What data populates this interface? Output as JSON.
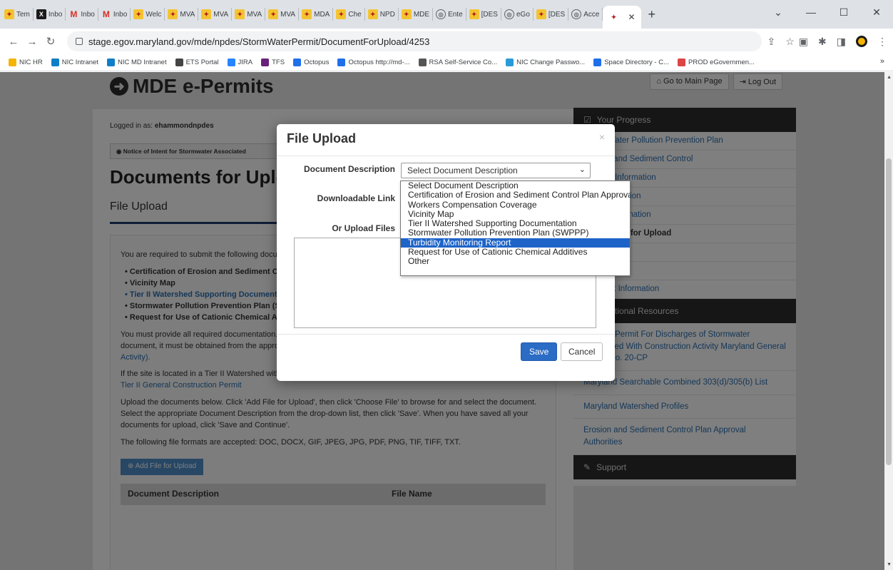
{
  "browser": {
    "tabs": [
      {
        "icon": "mde",
        "label": "Tem"
      },
      {
        "icon": "x",
        "label": "Inbo"
      },
      {
        "icon": "m",
        "label": "Inbo"
      },
      {
        "icon": "m",
        "label": "Inbo"
      },
      {
        "icon": "mde",
        "label": "Welc"
      },
      {
        "icon": "mde",
        "label": "MVA"
      },
      {
        "icon": "mde",
        "label": "MVA"
      },
      {
        "icon": "mde",
        "label": "MVA"
      },
      {
        "icon": "mde",
        "label": "MVA"
      },
      {
        "icon": "mde",
        "label": "MDA"
      },
      {
        "icon": "mde",
        "label": "Che"
      },
      {
        "icon": "mde",
        "label": "NPD"
      },
      {
        "icon": "mde",
        "label": "MDE"
      },
      {
        "icon": "g",
        "label": "Ente"
      },
      {
        "icon": "mde",
        "label": "[DES"
      },
      {
        "icon": "g",
        "label": "eGo"
      },
      {
        "icon": "mde",
        "label": "[DES"
      },
      {
        "icon": "g",
        "label": "Acce"
      }
    ],
    "url": "stage.egov.maryland.gov/mde/npdes/StormWaterPermit/DocumentForUpload/4253",
    "bookmarks": [
      "NIC HR",
      "NIC Intranet",
      "NIC MD Intranet",
      "ETS Portal",
      "JIRA",
      "TFS",
      "Octopus",
      "Octopus http://md-...",
      "RSA Self-Service Co...",
      "NIC Change Passwo...",
      "Space Directory - C...",
      "PROD eGovernmen..."
    ],
    "bookmarks_more": "»"
  },
  "site": {
    "logo": "MDE e-Permits",
    "go_main": "Go to Main Page",
    "logout": "Log Out",
    "logged_in_label": "Logged in as:",
    "logged_in_user": "ehammondnpdes",
    "breadcrumb": "Notice of Intent for Stormwater Associated",
    "page_title": "Documents for Upload",
    "section_title": "File Upload",
    "intro": "You are required to submit the following documents:",
    "required_docs": [
      {
        "label": "Certification of Erosion and Sediment Control Plan Approval",
        "link": false
      },
      {
        "label": "Vicinity Map",
        "link": false
      },
      {
        "label": "Tier II Watershed Supporting Documentation",
        "link": true
      },
      {
        "label": "Stormwater Pollution Prevention Plan (SWPPP)",
        "link": false
      },
      {
        "label": "Request for Use of Cationic Chemical Additives",
        "link": false
      }
    ],
    "para1": "You must provide all required documentation. If the site requires an Erosion and Sediment Control plan approval document, it must be obtained from the appropriate approval authority). More information is available on",
    "para1_link": "Construction Activity).",
    "para2": "If the site is located in a Tier II Watershed with no assimilative capacity you must contact MDE Tier II Review:",
    "para2_link": "Tier II General Construction Permit",
    "para3": "Upload the documents below. Click 'Add File for Upload', then click 'Choose File' to browse for and select the document. Select the appropriate Document Description from the drop-down list, then click 'Save'. When you have saved all your documents for upload, click 'Save and Continue'.",
    "para4": "The following file formats are accepted: DOC, DOCX, GIF, JPEG, JPG, PDF, PNG, TIF, TIFF, TXT.",
    "add_file": "Add File for Upload",
    "table_headers": [
      "Document Description",
      "File Name"
    ]
  },
  "sidebar": {
    "progress_title": "Your Progress",
    "progress_items": [
      {
        "label": "Storm Water Pollution Prevention Plan",
        "current": false
      },
      {
        "label": "Erosion and Sediment Control",
        "current": false
      },
      {
        "label": "General Information",
        "current": false
      },
      {
        "label": "Site Information",
        "current": false
      },
      {
        "label": "Owner Information",
        "current": false
      },
      {
        "label": "Documents for Upload",
        "current": true
      },
      {
        "label": "",
        "current": false
      },
      {
        "label": "",
        "current": false
      },
      {
        "label": "Payment Information",
        "current": false
      }
    ],
    "resources_title": "Additional Resources",
    "resources": [
      "General Permit For Discharges of Stormwater Associated With Construction Activity Maryland General Permit No. 20-CP",
      "Maryland Searchable Combined 303(d)/305(b) List",
      "Maryland Watershed Profiles",
      "Erosion and Sediment Control Plan Approval Authorities"
    ],
    "support_title": "Support"
  },
  "modal": {
    "title": "File Upload",
    "close": "×",
    "doc_desc_label": "Document Description",
    "download_label": "Downloadable Link",
    "upload_label": "Or Upload Files",
    "selected": "Select Document Description",
    "options": [
      "Select Document Description",
      "Certification of Erosion and Sediment Control Plan Approval",
      "Workers Compensation Coverage",
      "Vicinity Map",
      "Tier II Watershed Supporting Documentation",
      "Stormwater Pollution Prevention Plan (SWPPP)",
      "Turbidity Monitoring Report",
      "Request for Use of Cationic Chemical Additives",
      "Other"
    ],
    "highlighted_index": 6,
    "save": "Save",
    "cancel": "Cancel"
  },
  "colors": {
    "primary": "#2b6cc4",
    "highlight": "#1e64c8",
    "link": "#2a6fb0",
    "dark": "#2d2d2d"
  }
}
